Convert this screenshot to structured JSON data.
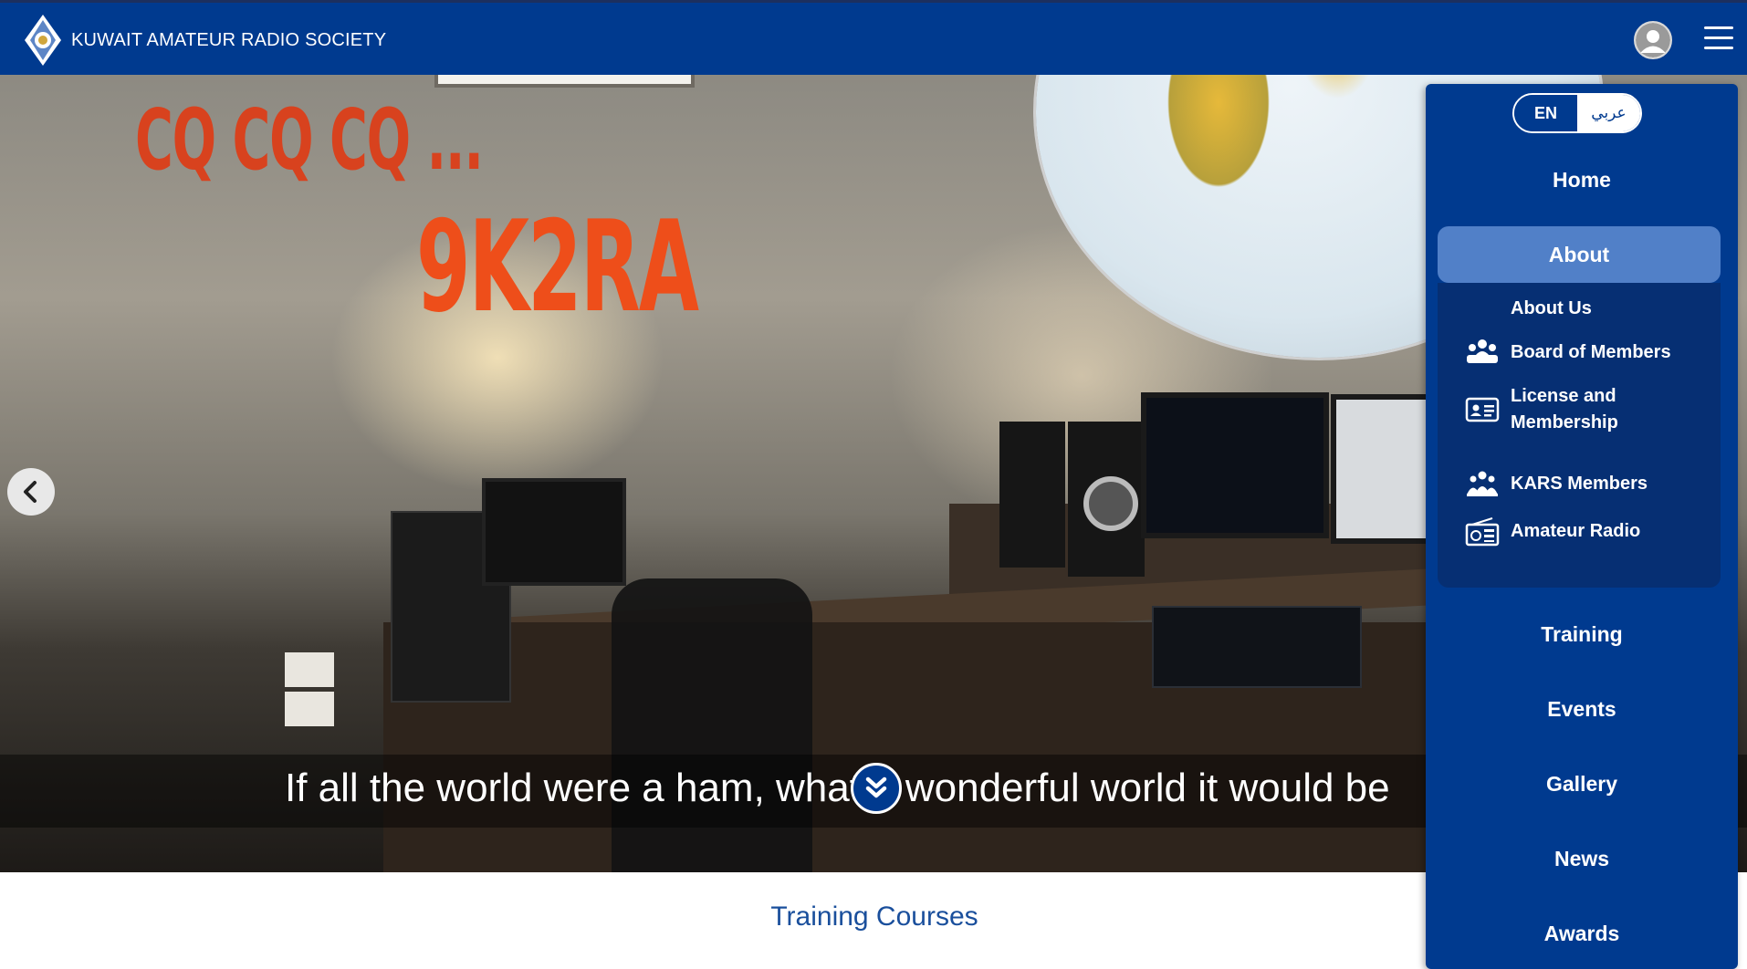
{
  "header": {
    "site_title": "KUWAIT AMATEUR RADIO SOCIETY",
    "logo_icon": "kars-diamond-logo",
    "user_icon": "user-avatar-icon",
    "menu_icon": "hamburger-menu-icon",
    "brand_color": "#003a8f"
  },
  "hero": {
    "wall_text_1": "CQ CQ CQ ...",
    "wall_text_2": "9K2RA",
    "caption": "If all the world were a ham, what a wonderful world it would be",
    "prev_icon": "chevron-left-icon",
    "scroll_icon": "double-chevron-down-icon",
    "slide_count": 5,
    "active_slide": 3
  },
  "section": {
    "title": "Training Courses"
  },
  "nav": {
    "lang_en": "EN",
    "lang_ar": "عربي",
    "home": "Home",
    "about": "About",
    "about_submenu": [
      {
        "label": "About Us",
        "icon": ""
      },
      {
        "label": "Board of Members",
        "icon": "group-people-icon"
      },
      {
        "label": "License and Membership",
        "icon": "id-card-icon"
      },
      {
        "label": "KARS Members",
        "icon": "members-people-icon"
      },
      {
        "label": "Amateur Radio",
        "icon": "radio-icon"
      }
    ],
    "training": "Training",
    "events": "Events",
    "gallery": "Gallery",
    "news": "News",
    "awards": "Awards",
    "active_color": "#5180c8"
  }
}
